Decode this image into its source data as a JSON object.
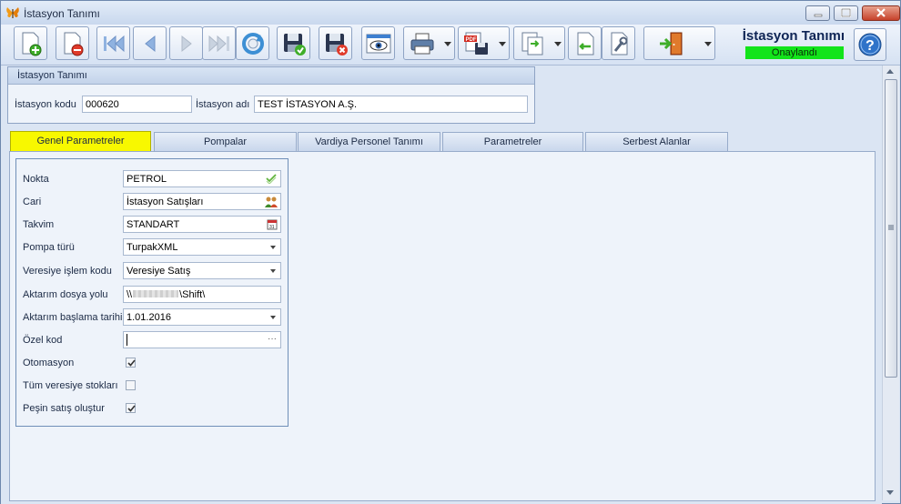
{
  "window": {
    "title": "İstasyon Tanımı"
  },
  "header": {
    "form_title": "İstasyon Tanımı",
    "status": "Onaylandı"
  },
  "toolbar": {
    "buttons": [
      "new-document",
      "delete-document",
      "first-record",
      "previous-record",
      "next-record",
      "last-record",
      "refresh",
      "save-and-approve",
      "save-and-cancel",
      "preview",
      "print",
      "export-pdf",
      "export",
      "import",
      "tools",
      "exit",
      "help"
    ]
  },
  "station": {
    "section_title": "İstasyon Tanımı",
    "code_label": "İstasyon kodu",
    "code_value": "000620",
    "name_label": "İstasyon adı",
    "name_value": "TEST İSTASYON A.Ş."
  },
  "tabs": [
    "Genel Parametreler",
    "Pompalar",
    "Vardiya Personel Tanımı",
    "Parametreler",
    "Serbest Alanlar"
  ],
  "general": {
    "fields": [
      {
        "label": "Nokta",
        "value": "PETROL"
      },
      {
        "label": "Cari",
        "value": "İstasyon Satışları"
      },
      {
        "label": "Takvim",
        "value": "STANDART"
      },
      {
        "label": "Pompa türü",
        "value": "TurpakXML"
      },
      {
        "label": "Veresiye işlem kodu",
        "value": "Veresiye Satış"
      },
      {
        "label": "Aktarım dosya yolu",
        "value_prefix": "\\\\",
        "value_suffix": "\\Shift\\"
      },
      {
        "label": "Aktarım başlama tarihi",
        "value": "1.01.2016"
      },
      {
        "label": "Özel kod",
        "value": ""
      }
    ],
    "checks": [
      {
        "label": "Otomasyon",
        "checked": true
      },
      {
        "label": "Tüm veresiye stokları",
        "checked": false
      },
      {
        "label": "Peşin satış oluştur",
        "checked": true
      }
    ]
  }
}
